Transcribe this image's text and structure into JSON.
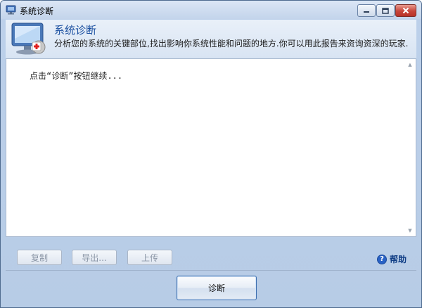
{
  "window": {
    "title": "系统诊断"
  },
  "header": {
    "title": "系统诊断",
    "description": "分析您的系统的关键部位,找出影响你系统性能和问题的地方.你可以用此报告来资询资深的玩家."
  },
  "output": {
    "text": "点击“诊断”按钮继续..."
  },
  "actions": {
    "copy_label": "复制",
    "export_label": "导出...",
    "upload_label": "上传"
  },
  "help": {
    "label": "帮助",
    "icon_glyph": "?"
  },
  "footer": {
    "diagnose_label": "诊断"
  },
  "colors": {
    "title_accent": "#1a4fa0",
    "disabled_text": "#8b96a6",
    "help_text": "#123f86",
    "close_button": "#c7453a"
  }
}
